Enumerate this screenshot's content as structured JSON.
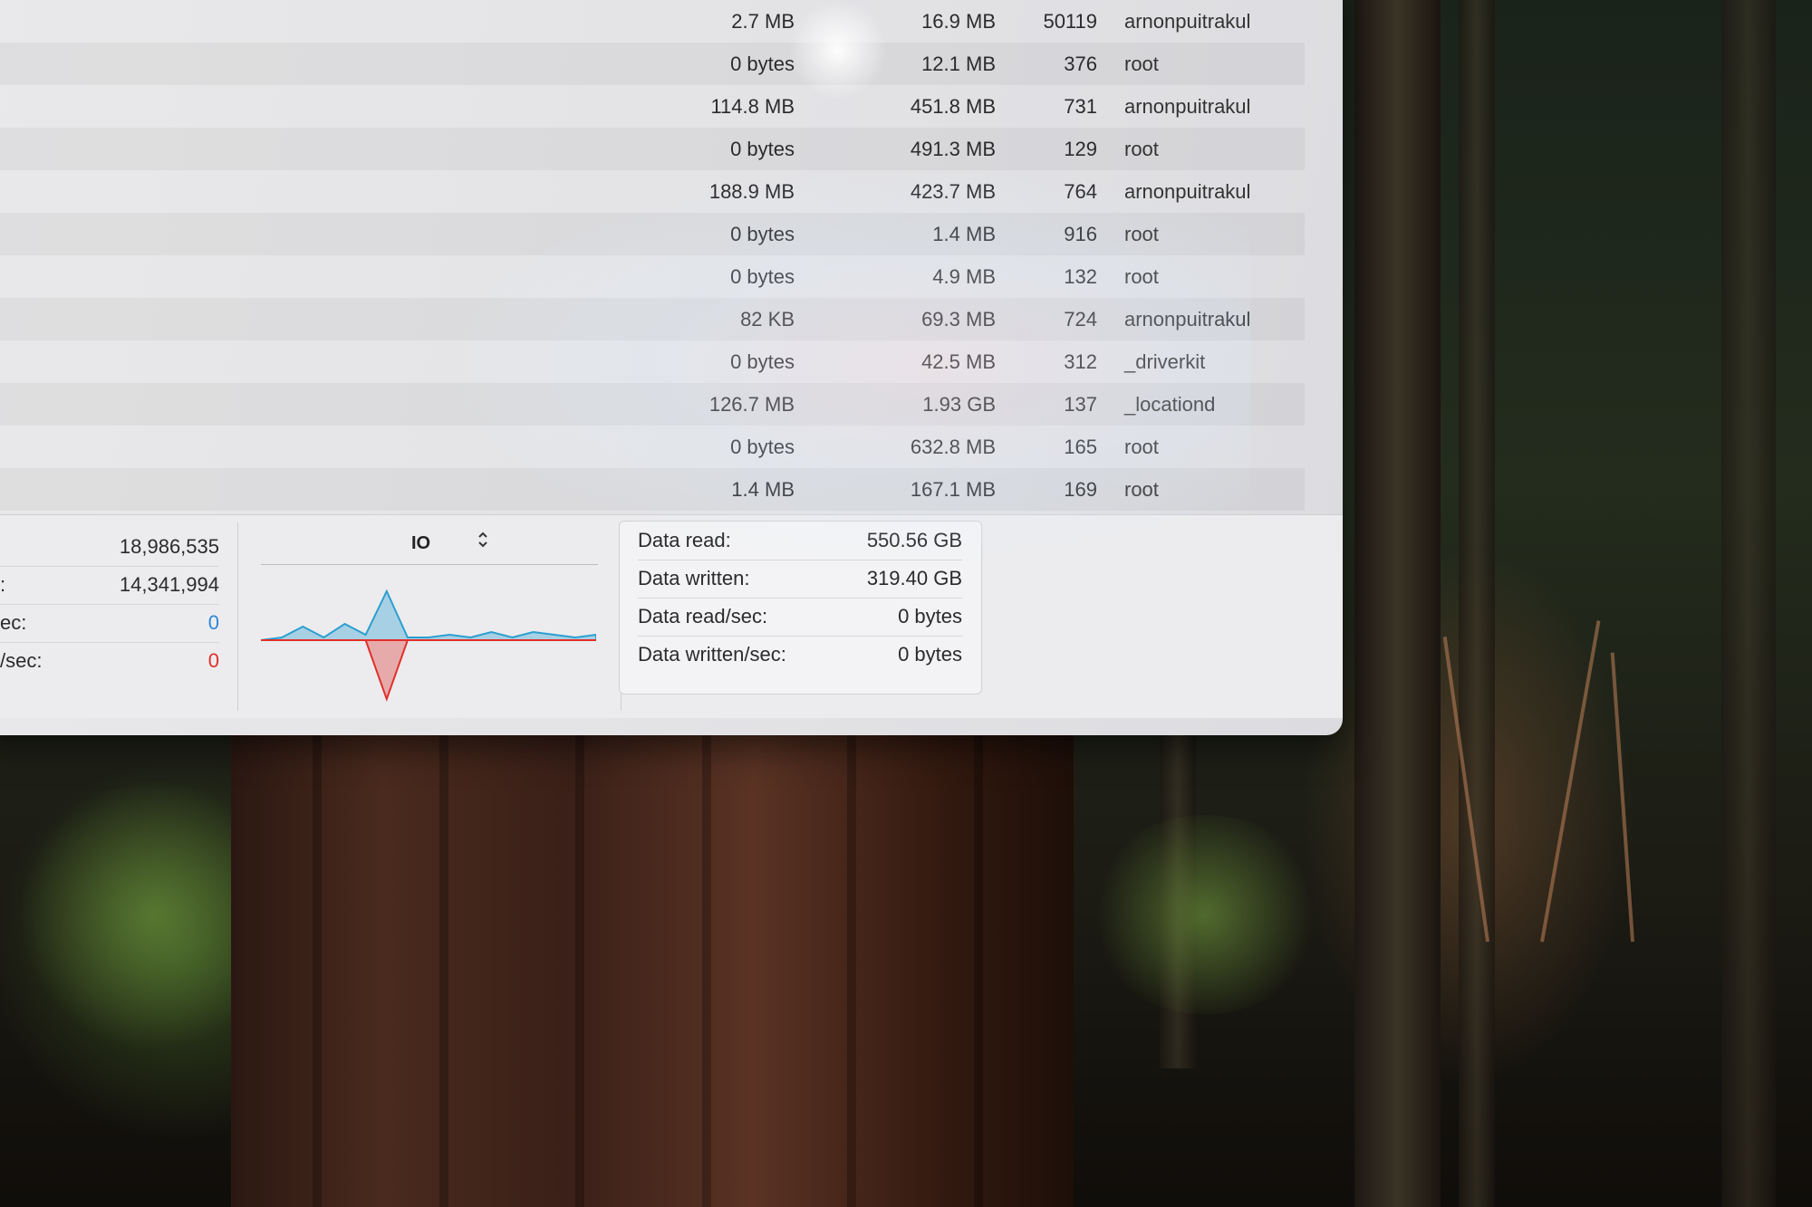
{
  "process_table": {
    "rows": [
      {
        "sent": "2.7 MB",
        "memory": "16.9 MB",
        "pid": "50119",
        "user": "arnonpuitrakul"
      },
      {
        "sent": "0 bytes",
        "memory": "12.1 MB",
        "pid": "376",
        "user": "root"
      },
      {
        "sent": "114.8 MB",
        "memory": "451.8 MB",
        "pid": "731",
        "user": "arnonpuitrakul"
      },
      {
        "sent": "0 bytes",
        "memory": "491.3 MB",
        "pid": "129",
        "user": "root"
      },
      {
        "sent": "188.9 MB",
        "memory": "423.7 MB",
        "pid": "764",
        "user": "arnonpuitrakul"
      },
      {
        "sent": "0 bytes",
        "memory": "1.4 MB",
        "pid": "916",
        "user": "root"
      },
      {
        "sent": "0 bytes",
        "memory": "4.9 MB",
        "pid": "132",
        "user": "root"
      },
      {
        "sent": "82 KB",
        "memory": "69.3 MB",
        "pid": "724",
        "user": "arnonpuitrakul"
      },
      {
        "sent": "0 bytes",
        "memory": "42.5 MB",
        "pid": "312",
        "user": "_driverkit"
      },
      {
        "sent": "126.7 MB",
        "memory": "1.93 GB",
        "pid": "137",
        "user": "_locationd"
      },
      {
        "sent": "0 bytes",
        "memory": "632.8 MB",
        "pid": "165",
        "user": "root"
      },
      {
        "sent": "1.4 MB",
        "memory": "167.1 MB",
        "pid": "169",
        "user": "root"
      }
    ]
  },
  "stats": {
    "reads_in_label": "",
    "reads_in_value": "18,986,535",
    "writes_out_label": ":",
    "writes_out_value": "14,341,994",
    "reads_sec_label": "ec:",
    "reads_sec_value": "0",
    "writes_sec_label": "/sec:",
    "writes_sec_value": "0"
  },
  "graph": {
    "selector_label": "IO",
    "chevron_icon": "up-down-chevron-icon",
    "read_color": "#2c9fd0",
    "write_color": "#e0302a",
    "read_values": [
      0,
      0.05,
      0.25,
      0.05,
      0.3,
      0.1,
      0.9,
      0.05,
      0.05,
      0.1,
      0.05,
      0.15,
      0.05,
      0.15,
      0.1,
      0.05,
      0.1
    ],
    "write_values": [
      0,
      0,
      0,
      0,
      0,
      0,
      1.0,
      0,
      0,
      0,
      0,
      0,
      0,
      0,
      0,
      0,
      0
    ]
  },
  "io_summary": {
    "data_read_label": "Data read:",
    "data_read_value": "550.56 GB",
    "data_written_label": "Data written:",
    "data_written_value": "319.40 GB",
    "data_read_sec_label": "Data read/sec:",
    "data_read_sec_value": "0 bytes",
    "data_written_sec_label": "Data written/sec:",
    "data_written_sec_value": "0 bytes"
  }
}
